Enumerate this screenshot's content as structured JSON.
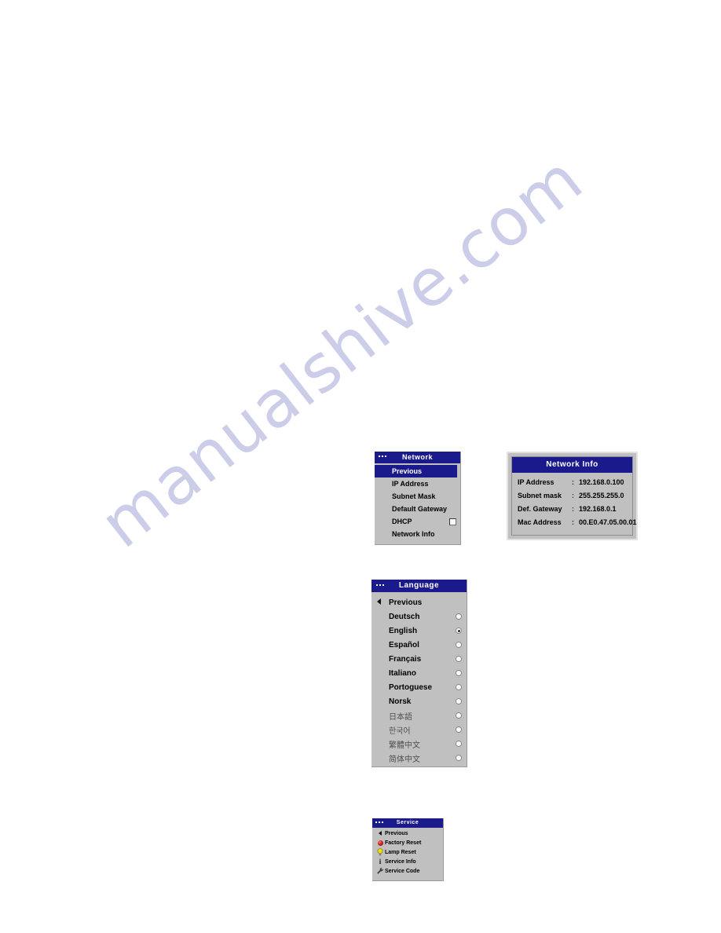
{
  "page": {
    "background_color": "#ffffff",
    "watermark_text": "manualshive.com",
    "watermark_color": "#c9cbe8"
  },
  "colors": {
    "osd_background": "#c0c0c0",
    "osd_title_background": "#1a1a8c",
    "osd_title_text": "#ffffff",
    "osd_text": "#000000",
    "highlight_background": "#1a1a8c",
    "highlight_text": "#ffffff",
    "disabled_text": "#4f4f4f"
  },
  "network_menu": {
    "title": "Network",
    "header_icon": "three-dots-icon",
    "back_marker_icon": "left-triangle-icon",
    "items": [
      {
        "label": "Previous",
        "selected": true,
        "control": "none"
      },
      {
        "label": "IP Address",
        "selected": false,
        "control": "none"
      },
      {
        "label": "Subnet Mask",
        "selected": false,
        "control": "none"
      },
      {
        "label": "Default Gateway",
        "selected": false,
        "control": "none"
      },
      {
        "label": "DHCP",
        "selected": false,
        "control": "checkbox",
        "checked": false
      },
      {
        "label": "Network Info",
        "selected": false,
        "control": "none"
      }
    ]
  },
  "network_info": {
    "title": "Network Info",
    "separator": ":",
    "rows": [
      {
        "key": "IP Address",
        "value": "192.168.0.100"
      },
      {
        "key": "Subnet mask",
        "value": "255.255.255.0"
      },
      {
        "key": "Def. Gateway",
        "value": "192.168.0.1"
      },
      {
        "key": "Mac Address",
        "value": "00.E0.47.05.00.01"
      }
    ]
  },
  "language_menu": {
    "title": "Language",
    "header_icon": "three-dots-icon",
    "back_marker_icon": "left-triangle-icon",
    "items": [
      {
        "label": "Previous",
        "control": "none",
        "dim": false
      },
      {
        "label": "Deutsch",
        "control": "radio",
        "selected": false,
        "dim": false
      },
      {
        "label": "English",
        "control": "radio",
        "selected": true,
        "dim": false
      },
      {
        "label": "Español",
        "control": "radio",
        "selected": false,
        "dim": false
      },
      {
        "label": "Français",
        "control": "radio",
        "selected": false,
        "dim": false
      },
      {
        "label": "Italiano",
        "control": "radio",
        "selected": false,
        "dim": false
      },
      {
        "label": "Portoguese",
        "control": "radio",
        "selected": false,
        "dim": false
      },
      {
        "label": "Norsk",
        "control": "radio",
        "selected": false,
        "dim": false
      },
      {
        "label": "日本語",
        "control": "radio",
        "selected": false,
        "dim": true
      },
      {
        "label": "한국어",
        "control": "radio",
        "selected": false,
        "dim": true
      },
      {
        "label": "繁體中文",
        "control": "radio",
        "selected": false,
        "dim": true
      },
      {
        "label": "简体中文",
        "control": "radio",
        "selected": false,
        "dim": true
      }
    ]
  },
  "service_menu": {
    "title": "Service",
    "header_icon": "three-dots-icon",
    "items": [
      {
        "label": "Previous",
        "icon": "left-triangle-icon"
      },
      {
        "label": "Factory Reset",
        "icon": "red-sphere-icon"
      },
      {
        "label": "Lamp Reset",
        "icon": "lightbulb-icon"
      },
      {
        "label": "Service Info",
        "icon": "info-i-icon"
      },
      {
        "label": "Service Code",
        "icon": "wrench-icon"
      }
    ]
  }
}
